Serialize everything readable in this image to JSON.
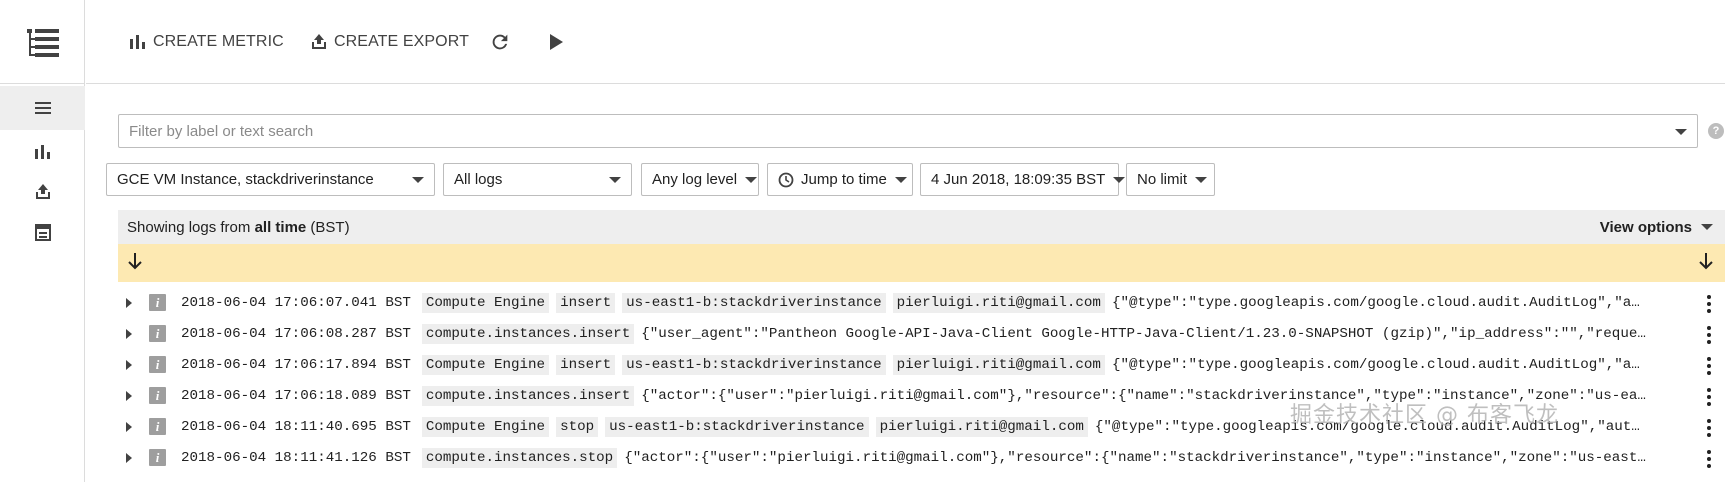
{
  "toolbar": {
    "create_metric_label": "CREATE METRIC",
    "create_export_label": "CREATE EXPORT"
  },
  "filter": {
    "placeholder": "Filter by label or text search"
  },
  "selectors": {
    "resource": "GCE VM Instance, stackdriverinstance",
    "logs": "All logs",
    "log_level": "Any log level",
    "jump": "Jump to time",
    "datetime": "4 Jun 2018, 18:09:35 BST",
    "limit": "No limit"
  },
  "info": {
    "prefix": "Showing logs from ",
    "range": "all time",
    "suffix": " (BST)",
    "view_options": "View options"
  },
  "logs": [
    {
      "timestamp": "2018-06-04 17:06:07.041 BST",
      "chips": [
        "Compute Engine",
        "insert",
        "us-east1-b:stackdriverinstance",
        "pierluigi.riti@gmail.com"
      ],
      "payload": "{\"@type\":\"type.googleapis.com/google.cloud.audit.AuditLog\",\"a…"
    },
    {
      "timestamp": "2018-06-04 17:06:08.287 BST",
      "chips": [
        "compute.instances.insert"
      ],
      "payload": "{\"user_agent\":\"Pantheon Google-API-Java-Client Google-HTTP-Java-Client/1.23.0-SNAPSHOT (gzip)\",\"ip_address\":\"\",\"reque…"
    },
    {
      "timestamp": "2018-06-04 17:06:17.894 BST",
      "chips": [
        "Compute Engine",
        "insert",
        "us-east1-b:stackdriverinstance",
        "pierluigi.riti@gmail.com"
      ],
      "payload": "{\"@type\":\"type.googleapis.com/google.cloud.audit.AuditLog\",\"a…"
    },
    {
      "timestamp": "2018-06-04 17:06:18.089 BST",
      "chips": [
        "compute.instances.insert"
      ],
      "payload": "{\"actor\":{\"user\":\"pierluigi.riti@gmail.com\"},\"resource\":{\"name\":\"stackdriverinstance\",\"type\":\"instance\",\"zone\":\"us-ea…"
    },
    {
      "timestamp": "2018-06-04 18:11:40.695 BST",
      "chips": [
        "Compute Engine",
        "stop",
        "us-east1-b:stackdriverinstance",
        "pierluigi.riti@gmail.com"
      ],
      "payload": "{\"@type\":\"type.googleapis.com/google.cloud.audit.AuditLog\",\"aut…"
    },
    {
      "timestamp": "2018-06-04 18:11:41.126 BST",
      "chips": [
        "compute.instances.stop"
      ],
      "payload": "{\"actor\":{\"user\":\"pierluigi.riti@gmail.com\"},\"resource\":{\"name\":\"stackdriverinstance\",\"type\":\"instance\",\"zone\":\"us-east…"
    }
  ],
  "watermark": "掘金技术社区 @ 布客飞龙",
  "icons": {
    "logo": "logs-viewer-icon",
    "rail": [
      "list-icon",
      "bar-chart-icon",
      "export-icon",
      "storage-icon"
    ],
    "severity": "info-icon"
  }
}
